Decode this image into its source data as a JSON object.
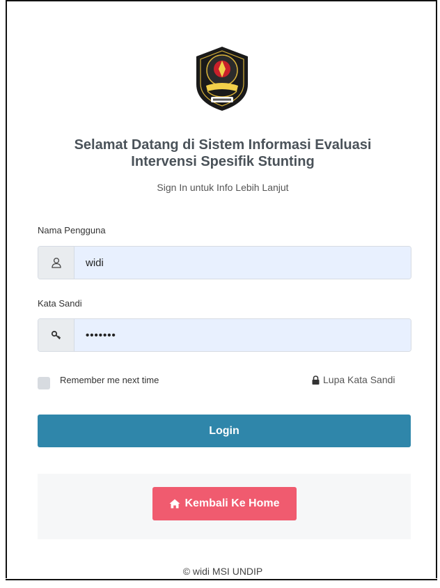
{
  "heading": {
    "line1": "Selamat Datang di Sistem Informasi Evaluasi",
    "line2": "Intervensi Spesifik Stunting",
    "subtitle": "Sign In untuk Info Lebih Lanjut"
  },
  "username": {
    "label": "Nama Pengguna",
    "value": "widi",
    "icon": "user-icon"
  },
  "password": {
    "label": "Kata Sandi",
    "value": "•••••••",
    "icon": "key-icon"
  },
  "remember": {
    "label": "Remember me next time",
    "checked": false
  },
  "forgot": {
    "label": "Lupa Kata Sandi",
    "icon": "lock-icon"
  },
  "login": {
    "label": "Login"
  },
  "home": {
    "label": "Kembali Ke Home",
    "icon": "home-icon"
  },
  "footer": {
    "text": "© widi MSI UNDIP"
  },
  "colors": {
    "login_button": "#2f86aa",
    "home_button": "#f05b6f",
    "input_fill": "#e8f0fe"
  }
}
